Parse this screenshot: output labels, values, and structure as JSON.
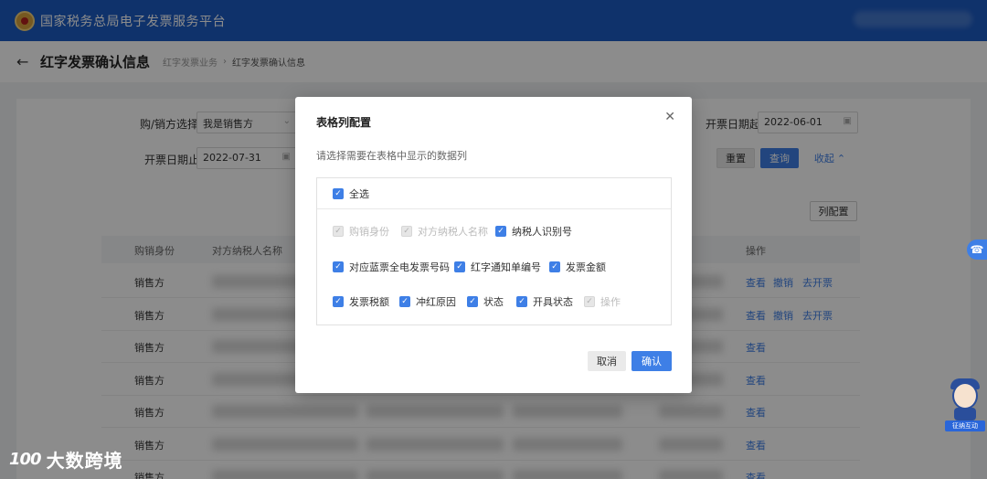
{
  "header": {
    "platform_title": "国家税务总局电子发票服务平台"
  },
  "subheader": {
    "page_title": "红字发票确认信息",
    "breadcrumb": [
      "红字发票业务",
      "红字发票确认信息"
    ]
  },
  "filters": {
    "buyer_seller_label": "购/销方选择",
    "buyer_seller_value": "我是销售方",
    "start_date_label": "开票日期起",
    "start_date_value": "2022-06-01",
    "end_date_label": "开票日期止",
    "end_date_value": "2022-07-31",
    "reset_label": "重置",
    "query_label": "查询",
    "collapse_label": "收起"
  },
  "table": {
    "column_config_label": "列配置",
    "headers": {
      "role": "购销身份",
      "counterparty": "对方纳税人名称",
      "actions": "操作"
    },
    "rows": [
      {
        "role": "销售方",
        "actions": [
          "查看",
          "撤销",
          "去开票"
        ]
      },
      {
        "role": "销售方",
        "actions": [
          "查看",
          "撤销",
          "去开票"
        ]
      },
      {
        "role": "销售方",
        "actions": [
          "查看"
        ]
      },
      {
        "role": "销售方",
        "actions": [
          "查看"
        ]
      },
      {
        "role": "销售方",
        "actions": [
          "查看"
        ]
      },
      {
        "role": "销售方",
        "actions": [
          "查看"
        ]
      },
      {
        "role": "销售方",
        "actions": [
          "查看"
        ]
      }
    ]
  },
  "modal": {
    "title": "表格列配置",
    "description": "请选择需要在表格中显示的数据列",
    "select_all_label": "全选",
    "options": [
      {
        "label": "购销身份",
        "checked": true,
        "disabled": true
      },
      {
        "label": "对方纳税人名称",
        "checked": true,
        "disabled": true
      },
      {
        "label": "纳税人识别号",
        "checked": true,
        "disabled": false
      },
      {
        "label": "对应蓝票全电发票号码",
        "checked": true,
        "disabled": false
      },
      {
        "label": "红字通知单编号",
        "checked": true,
        "disabled": false
      },
      {
        "label": "发票金额",
        "checked": true,
        "disabled": false
      },
      {
        "label": "发票税额",
        "checked": true,
        "disabled": false
      },
      {
        "label": "冲红原因",
        "checked": true,
        "disabled": false
      },
      {
        "label": "状态",
        "checked": true,
        "disabled": false
      },
      {
        "label": "开具状态",
        "checked": true,
        "disabled": false
      },
      {
        "label": "操作",
        "checked": true,
        "disabled": true
      }
    ],
    "cancel_label": "取消",
    "confirm_label": "确认"
  },
  "widgets": {
    "mascot_label": "征纳互动",
    "watermark_text": "大数跨境",
    "watermark_logo": "100"
  },
  "colors": {
    "header_blue": "#1c5bc3",
    "accent": "#3e7fe6"
  }
}
